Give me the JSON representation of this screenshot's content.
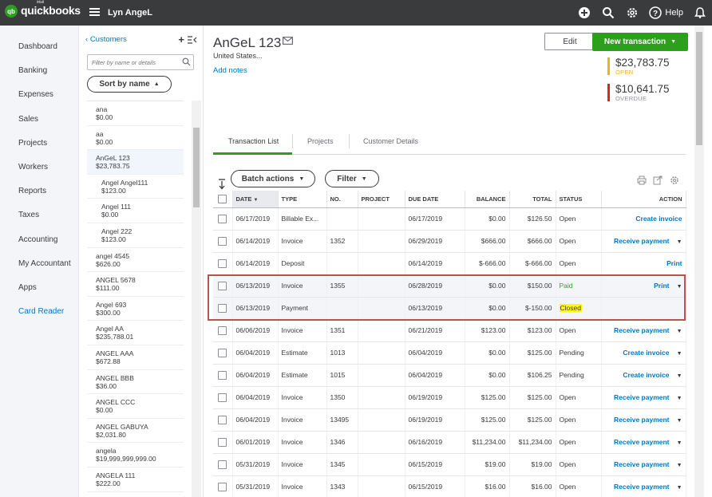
{
  "app": {
    "logo_small": "intuit",
    "logo_mark": "qb",
    "logo": "quickbooks",
    "company": "Lyn AngeL",
    "help_label": "Help"
  },
  "nav": [
    "Dashboard",
    "Banking",
    "Expenses",
    "Sales",
    "Projects",
    "Workers",
    "Reports",
    "Taxes",
    "Accounting",
    "My Accountant",
    "Apps",
    "Card Reader"
  ],
  "customers_panel": {
    "back_label": "Customers",
    "filter_placeholder": "Filter by name or details",
    "sort_label": "Sort by name",
    "items": [
      {
        "name": "ana",
        "balance": "$0.00",
        "child": false,
        "selected": false
      },
      {
        "name": "aa",
        "balance": "$0.00",
        "child": false,
        "selected": false
      },
      {
        "name": "AnGeL 123",
        "balance": "$23,783.75",
        "child": false,
        "selected": true
      },
      {
        "name": "Angel Angel111",
        "balance": "$123.00",
        "child": true,
        "selected": false
      },
      {
        "name": "Angel 111",
        "balance": "$0.00",
        "child": true,
        "selected": false
      },
      {
        "name": "Angel 222",
        "balance": "$123.00",
        "child": true,
        "selected": false
      },
      {
        "name": "angel 4545",
        "balance": "$626.00",
        "child": false,
        "selected": false
      },
      {
        "name": "ANGEL 5678",
        "balance": "$111.00",
        "child": false,
        "selected": false
      },
      {
        "name": "Angel 693",
        "balance": "$300.00",
        "child": false,
        "selected": false
      },
      {
        "name": "Angel AA",
        "balance": "$235,788.01",
        "child": false,
        "selected": false
      },
      {
        "name": "ANGEL AAA",
        "balance": "$672.88",
        "child": false,
        "selected": false
      },
      {
        "name": "ANGEL BBB",
        "balance": "$36.00",
        "child": false,
        "selected": false
      },
      {
        "name": "ANGEL CCC",
        "balance": "$0.00",
        "child": false,
        "selected": false
      },
      {
        "name": "ANGEL GABUYA",
        "balance": "$2,031.80",
        "child": false,
        "selected": false
      },
      {
        "name": "angela",
        "balance": "$19,999,999,999.00",
        "child": false,
        "selected": false
      },
      {
        "name": "ANGELA 111",
        "balance": "$222.00",
        "child": false,
        "selected": false
      }
    ]
  },
  "customer": {
    "name": "AnGeL 123",
    "address": "United States...",
    "add_notes": "Add notes",
    "edit_label": "Edit",
    "new_tx_label": "New transaction",
    "open_amount": "$23,783.75",
    "open_label": "OPEN",
    "overdue_amount": "$10,641.75",
    "overdue_label": "OVERDUE"
  },
  "tabs": [
    "Transaction List",
    "Projects",
    "Customer Details"
  ],
  "toolbar": {
    "batch_label": "Batch actions",
    "filter_label": "Filter"
  },
  "columns": {
    "date": "DATE",
    "type": "TYPE",
    "no": "NO.",
    "project": "PROJECT",
    "due": "DUE DATE",
    "balance": "BALANCE",
    "total": "TOTAL",
    "status": "STATUS",
    "action": "ACTION"
  },
  "rows": [
    {
      "date": "06/17/2019",
      "type": "Billable Ex...",
      "no": "",
      "project": "",
      "due": "06/17/2019",
      "balance": "$0.00",
      "total": "$126.50",
      "status": "Open",
      "action": "Create invoice",
      "caret": false
    },
    {
      "date": "06/14/2019",
      "type": "Invoice",
      "no": "1352",
      "project": "",
      "due": "06/29/2019",
      "balance": "$666.00",
      "total": "$666.00",
      "status": "Open",
      "action": "Receive payment",
      "caret": true
    },
    {
      "date": "06/14/2019",
      "type": "Deposit",
      "no": "",
      "project": "",
      "due": "06/14/2019",
      "balance": "$-666.00",
      "total": "$-666.00",
      "status": "Open",
      "action": "Print",
      "caret": false
    },
    {
      "date": "06/13/2019",
      "type": "Invoice",
      "no": "1355",
      "project": "",
      "due": "06/28/2019",
      "balance": "$0.00",
      "total": "$150.00",
      "status": "Paid",
      "action": "Print",
      "caret": true
    },
    {
      "date": "06/13/2019",
      "type": "Payment",
      "no": "",
      "project": "",
      "due": "06/13/2019",
      "balance": "$0.00",
      "total": "$-150.00",
      "status": "Closed",
      "action": "",
      "caret": false
    },
    {
      "date": "06/06/2019",
      "type": "Invoice",
      "no": "1351",
      "project": "",
      "due": "06/21/2019",
      "balance": "$123.00",
      "total": "$123.00",
      "status": "Open",
      "action": "Receive payment",
      "caret": true
    },
    {
      "date": "06/04/2019",
      "type": "Estimate",
      "no": "1013",
      "project": "",
      "due": "06/04/2019",
      "balance": "$0.00",
      "total": "$125.00",
      "status": "Pending",
      "action": "Create invoice",
      "caret": true
    },
    {
      "date": "06/04/2019",
      "type": "Estimate",
      "no": "1015",
      "project": "",
      "due": "06/04/2019",
      "balance": "$0.00",
      "total": "$106.25",
      "status": "Pending",
      "action": "Create invoice",
      "caret": true
    },
    {
      "date": "06/04/2019",
      "type": "Invoice",
      "no": "1350",
      "project": "",
      "due": "06/19/2019",
      "balance": "$125.00",
      "total": "$125.00",
      "status": "Open",
      "action": "Receive payment",
      "caret": true
    },
    {
      "date": "06/04/2019",
      "type": "Invoice",
      "no": "13495",
      "project": "",
      "due": "06/19/2019",
      "balance": "$125.00",
      "total": "$125.00",
      "status": "Open",
      "action": "Receive payment",
      "caret": true
    },
    {
      "date": "06/01/2019",
      "type": "Invoice",
      "no": "1346",
      "project": "",
      "due": "06/16/2019",
      "balance": "$11,234.00",
      "total": "$11,234.00",
      "status": "Open",
      "action": "Receive payment",
      "caret": true
    },
    {
      "date": "05/31/2019",
      "type": "Invoice",
      "no": "1345",
      "project": "",
      "due": "06/15/2019",
      "balance": "$19.00",
      "total": "$19.00",
      "status": "Open",
      "action": "Receive payment",
      "caret": true
    },
    {
      "date": "05/31/2019",
      "type": "Invoice",
      "no": "1343",
      "project": "",
      "due": "06/15/2019",
      "balance": "$16.00",
      "total": "$16.00",
      "status": "Open",
      "action": "Receive payment",
      "caret": true
    }
  ],
  "colors": {
    "topbar": "#3a3b3c",
    "accent_green": "#2ca01c",
    "link_blue": "#0077c5",
    "open_bar": "#f2b01e",
    "overdue_bar": "#d52b1e",
    "highlight_box": "#c0504d",
    "closed_highlight": "#ffff00"
  },
  "icons": [
    "hamburger-icon",
    "plus-circle-icon",
    "search-icon",
    "gear-icon",
    "help-icon",
    "bell-icon",
    "mail-icon",
    "print-icon",
    "export-icon",
    "settings-icon",
    "sort-arrow-icon"
  ]
}
